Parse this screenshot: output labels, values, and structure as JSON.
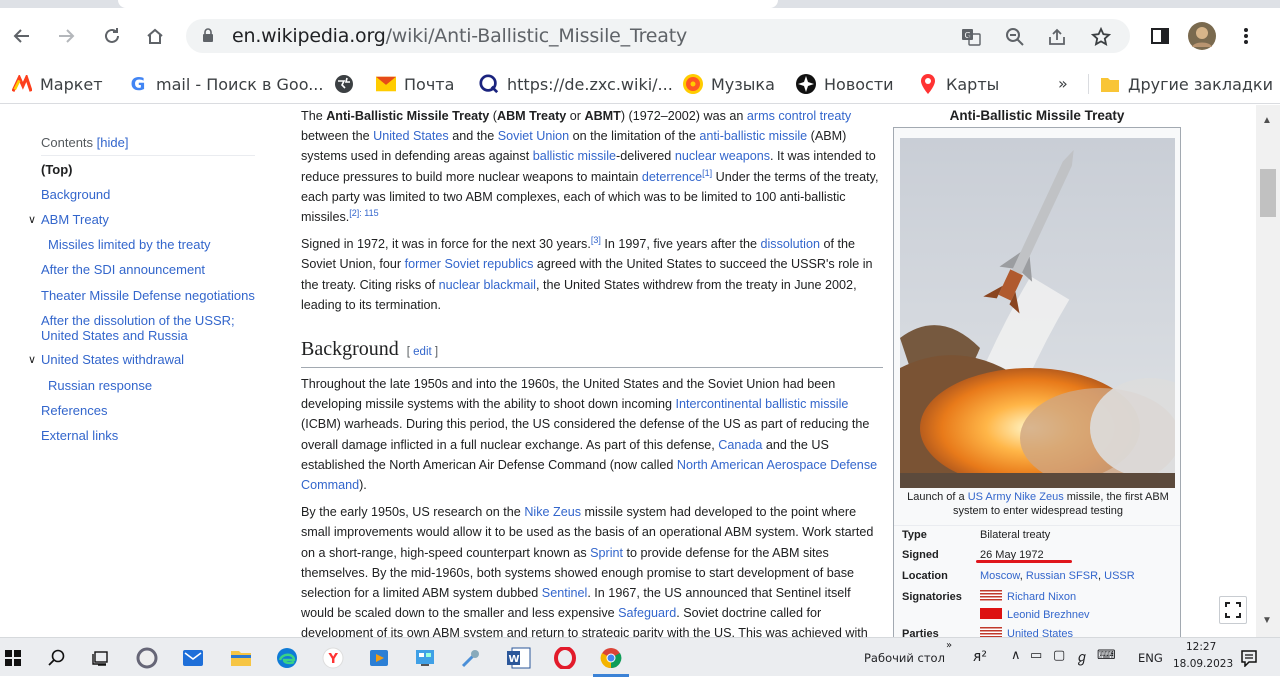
{
  "browser": {
    "url_domain": "en.wikipedia.org",
    "url_path": "/wiki/Anti-Ballistic_Missile_Treaty"
  },
  "bookmarks": {
    "items": [
      {
        "label": "Маркет",
        "icon": "market-icon"
      },
      {
        "label": "mail - Поиск в Goo...",
        "icon": "google-icon"
      },
      {
        "label": "",
        "icon": "globe-icon"
      },
      {
        "label": "Почта",
        "icon": "mail-icon"
      },
      {
        "label": "https://de.zxc.wiki/...",
        "icon": "zxc-wiki-icon"
      },
      {
        "label": "Музыка",
        "icon": "music-icon"
      },
      {
        "label": "Новости",
        "icon": "news-icon"
      },
      {
        "label": "Карты",
        "icon": "maps-pin-icon"
      }
    ],
    "overflow": "»",
    "other": "Другие закладки"
  },
  "toc": {
    "heading": "Contents",
    "hide": "[hide]",
    "items": [
      "(Top)",
      "Background",
      "ABM Treaty",
      "Missiles limited by the treaty",
      "After the SDI announcement",
      "Theater Missile Defense negotiations",
      "After the dissolution of the USSR;",
      "United States and Russia",
      "United States withdrawal",
      "Russian response",
      "References",
      "External links"
    ]
  },
  "article": {
    "p1": {
      "t1": "The ",
      "b1": "Anti-Ballistic Missile Treaty",
      "t2": " (",
      "b2": "ABM Treaty",
      "t3": " or ",
      "b3": "ABMT",
      "t4": ") (1972–2002) was an ",
      "l1": "arms control treaty",
      "t5": " between the ",
      "l2": "United States",
      "t6": " and the ",
      "l3": "Soviet Union",
      "t7": " on the limitation of the ",
      "l4": "anti-ballistic missile",
      "t8": " (ABM) systems used in defending areas against ",
      "l5": "ballistic missile",
      "t9": "-delivered ",
      "l6": "nuclear weapons",
      "t10": ". It was intended to reduce pressures to build more nuclear weapons to maintain ",
      "l7": "deterrence",
      "s1": "[1]",
      "t11": " Under the terms of the treaty, each party was limited to two ABM complexes, each of which was to be limited to 100 anti-ballistic missiles.",
      "s2": "[2]: 115"
    },
    "p2": {
      "t1": "Signed in 1972, it was in force for the next 30 years.",
      "s1": "[3]",
      "t2": " In 1997, five years after the ",
      "l1": "dissolution",
      "t3": " of the Soviet Union, four ",
      "l2": "former Soviet republics",
      "t4": " agreed with the United States to succeed the USSR's role in the treaty. Citing risks of ",
      "l3": "nuclear blackmail",
      "t5": ", the United States withdrew from the treaty in June 2002, leading to its termination."
    },
    "h_background": "Background",
    "edit": "edit",
    "p3": {
      "t1": "Throughout the late 1950s and into the 1960s, the United States and the Soviet Union had been developing missile systems with the ability to shoot down incoming ",
      "l1": "Intercontinental ballistic missile",
      "t2": " (ICBM) warheads. During this period, the US considered the defense of the US as part of reducing the overall damage inflicted in a full nuclear exchange. As part of this defense, ",
      "l2": "Canada",
      "t3": " and the US established the North American Air Defense Command (now called ",
      "l3": "North American Aerospace Defense Command",
      "t4": ")."
    },
    "p4": {
      "t1": "By the early 1950s, US research on the ",
      "l1": "Nike Zeus",
      "t2": " missile system had developed to the point where small improvements would allow it to be used as the basis of an operational ABM system. Work started on a short-range, high-speed counterpart known as ",
      "l2": "Sprint",
      "t3": " to provide defense for the ABM sites themselves. By the mid-1960s, both systems showed enough promise to start development of base selection for a limited ABM system dubbed ",
      "l3": "Sentinel",
      "t4": ". In 1967, the US announced that Sentinel itself would be scaled down to the smaller and less expensive ",
      "l4": "Safeguard",
      "t5": ". Soviet doctrine called for development of its own ABM system and return to strategic parity with the US. This was achieved with"
    }
  },
  "infobox": {
    "title": "Anti-Ballistic Missile Treaty",
    "caption": {
      "t1": "Launch of a ",
      "l1": "US Army",
      "t2": " ",
      "l2": "Nike Zeus",
      "t3": " missile, the first ABM system to enter widespread testing"
    },
    "rows": {
      "type_label": "Type",
      "type_value": "Bilateral treaty",
      "signed_label": "Signed",
      "signed_value": "26 May 1972",
      "location_label": "Location",
      "location_l1": "Moscow",
      "location_sep1": ", ",
      "location_l2": "Russian SFSR",
      "location_sep2": ", ",
      "location_l3": "USSR",
      "signatories_label": "Signatories",
      "signatory1": "Richard Nixon",
      "signatory2": "Leonid Brezhnev",
      "parties_label": "Parties",
      "party1": "United States"
    }
  },
  "taskbar": {
    "desktop_label": "Рабочий стол",
    "lang": "ENG",
    "time": "12:27",
    "date": "18.09.2023"
  },
  "colors": {
    "link": "#3366cc",
    "highlight_underline": "#e0161c"
  }
}
